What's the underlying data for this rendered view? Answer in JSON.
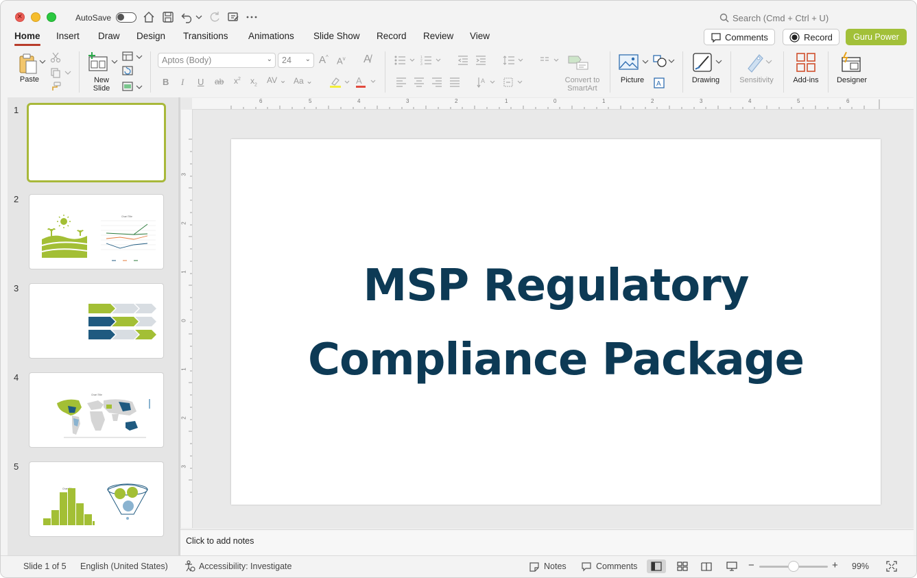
{
  "titlebar": {
    "autosave_label": "AutoSave",
    "search_placeholder": "Search (Cmd + Ctrl + U)"
  },
  "tabs": [
    {
      "label": "Home",
      "active": true
    },
    {
      "label": "Insert"
    },
    {
      "label": "Draw"
    },
    {
      "label": "Design"
    },
    {
      "label": "Transitions"
    },
    {
      "label": "Animations"
    },
    {
      "label": "Slide Show"
    },
    {
      "label": "Record"
    },
    {
      "label": "Review"
    },
    {
      "label": "View"
    }
  ],
  "header_buttons": {
    "comments": "Comments",
    "record": "Record",
    "addin": "Guru Power"
  },
  "ribbon": {
    "paste": "Paste",
    "new_slide_line1": "New",
    "new_slide_line2": "Slide",
    "font_name": "Aptos (Body)",
    "font_size": "24",
    "convert_line1": "Convert to",
    "convert_line2": "SmartArt",
    "picture": "Picture",
    "drawing": "Drawing",
    "sensitivity": "Sensitivity",
    "addins": "Add-ins",
    "designer": "Designer"
  },
  "slides": [
    {
      "number": "1"
    },
    {
      "number": "2"
    },
    {
      "number": "3"
    },
    {
      "number": "4"
    },
    {
      "number": "5"
    }
  ],
  "thumb_chart_title": "Chart Title",
  "slide": {
    "title_line1": "MSP Regulatory",
    "title_line2": "Compliance Package"
  },
  "rulers": {
    "horizontal": [
      "6",
      "5",
      "4",
      "3",
      "2",
      "1",
      "0",
      "1",
      "2",
      "3",
      "4",
      "5",
      "6"
    ],
    "vertical": [
      "3",
      "2",
      "1",
      "0",
      "1",
      "2",
      "3"
    ]
  },
  "notes_placeholder": "Click to add notes",
  "status": {
    "slide_counter": "Slide 1 of 5",
    "language": "English (United States)",
    "accessibility": "Accessibility: Investigate",
    "notes": "Notes",
    "comments": "Comments",
    "zoom": "99%"
  },
  "colors": {
    "title": "#0d3a55",
    "accent_green": "#a2c039",
    "tab_underline": "#b83c2a"
  }
}
